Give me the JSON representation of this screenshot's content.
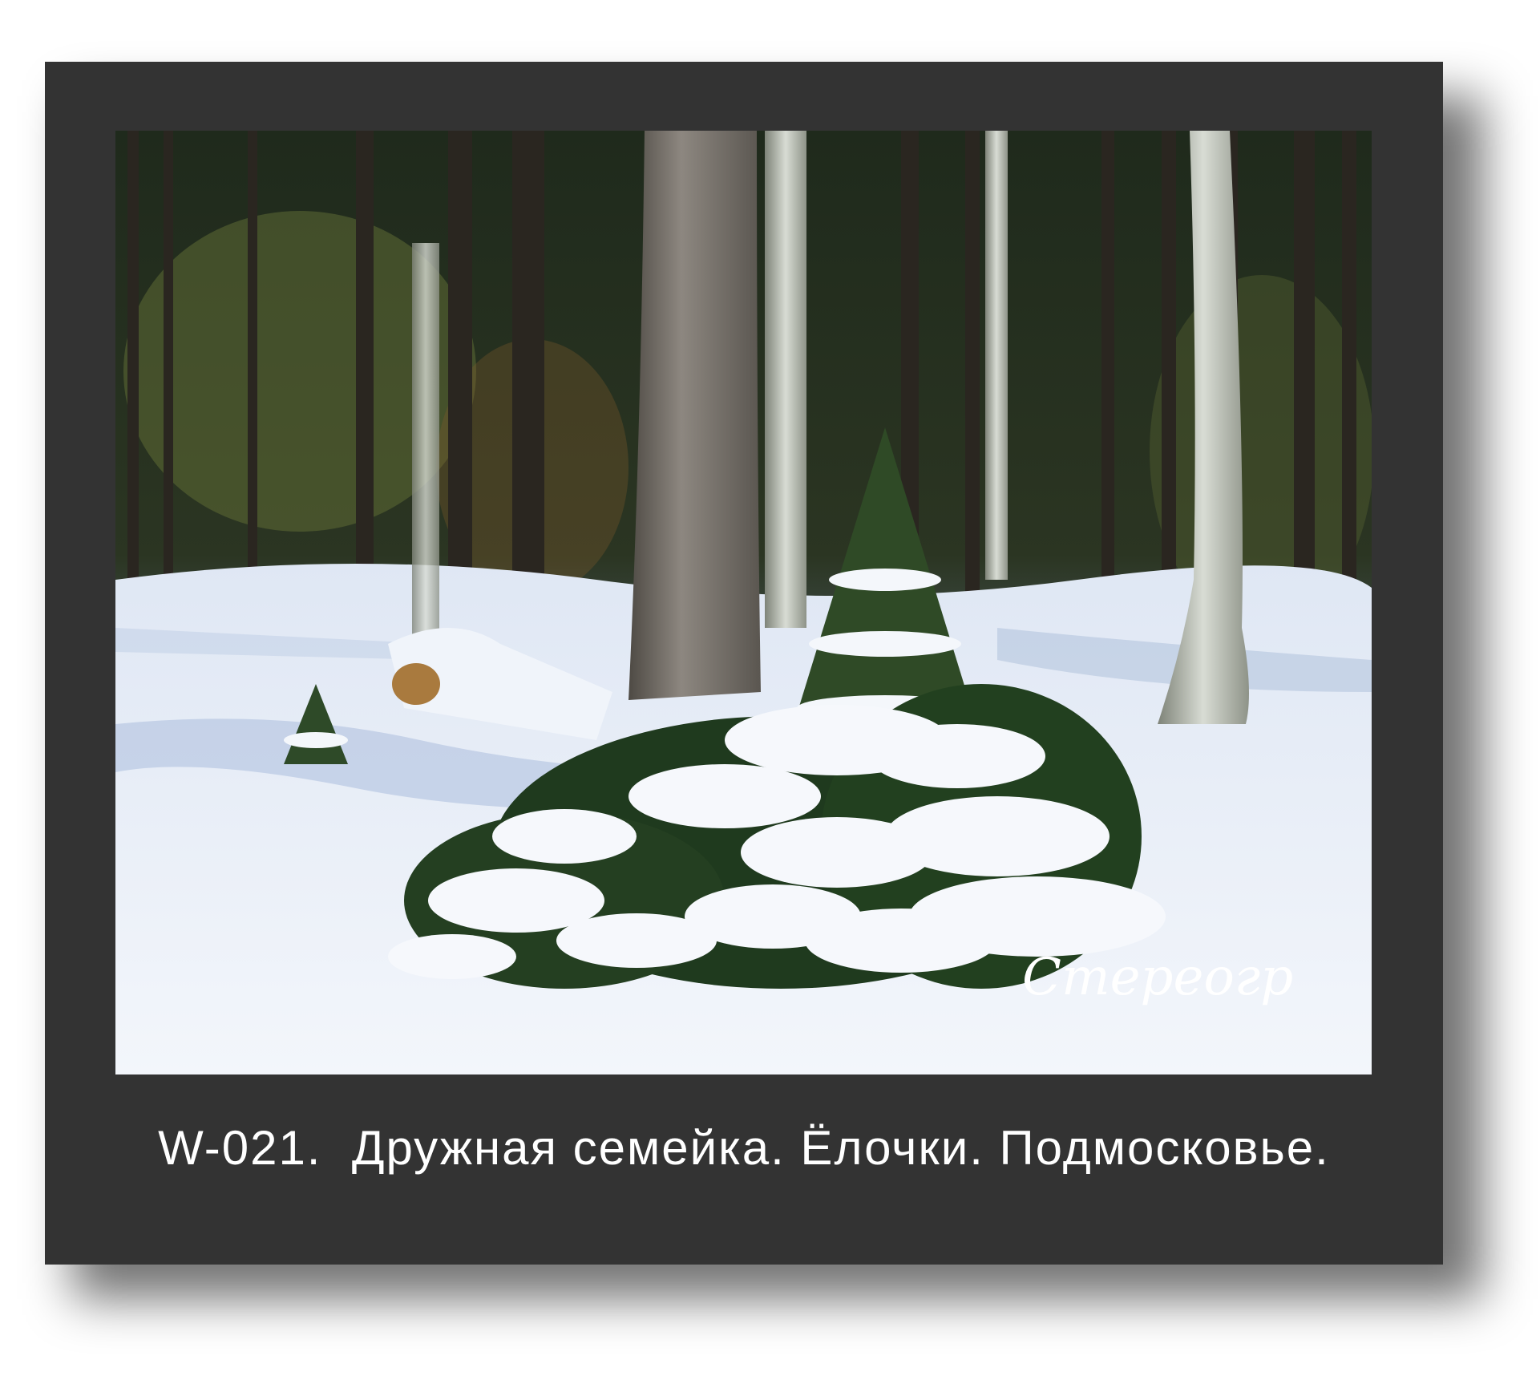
{
  "caption": "W-021.  Дружная семейка. Ёлочки. Подмосковье.",
  "watermark": "Стереоград",
  "colors": {
    "frame": "#333333",
    "caption_text": "#ffffff"
  }
}
